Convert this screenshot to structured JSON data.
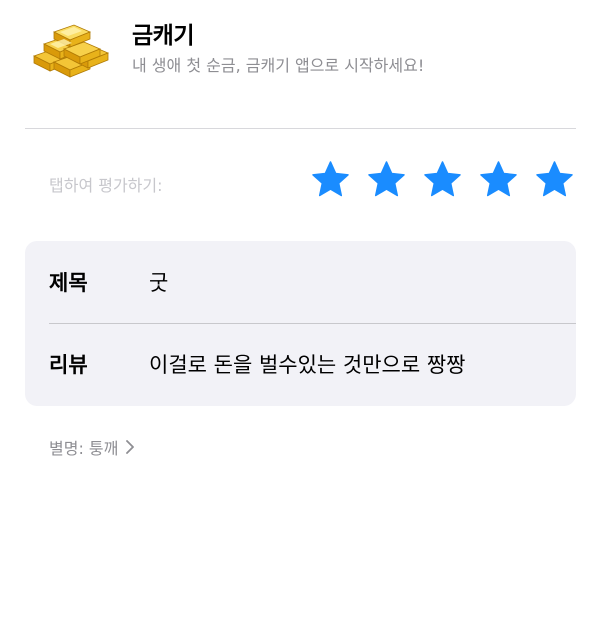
{
  "app": {
    "name": "금캐기",
    "subtitle": "내 생애 첫 순금, 금캐기 앱으로 시작하세요!",
    "icon": "gold-bars-icon"
  },
  "rating": {
    "prompt": "탭하여 평가하기:",
    "stars_filled": 5,
    "stars_total": 5,
    "star_color": "#1a8cff"
  },
  "form": {
    "title_label": "제목",
    "title_value": "굿",
    "review_label": "리뷰",
    "review_value": "이걸로 돈을 벌수있는 것만으로 짱짱"
  },
  "nickname": {
    "text": "별명: 퉁깨",
    "icon": "chevron-right-icon"
  }
}
